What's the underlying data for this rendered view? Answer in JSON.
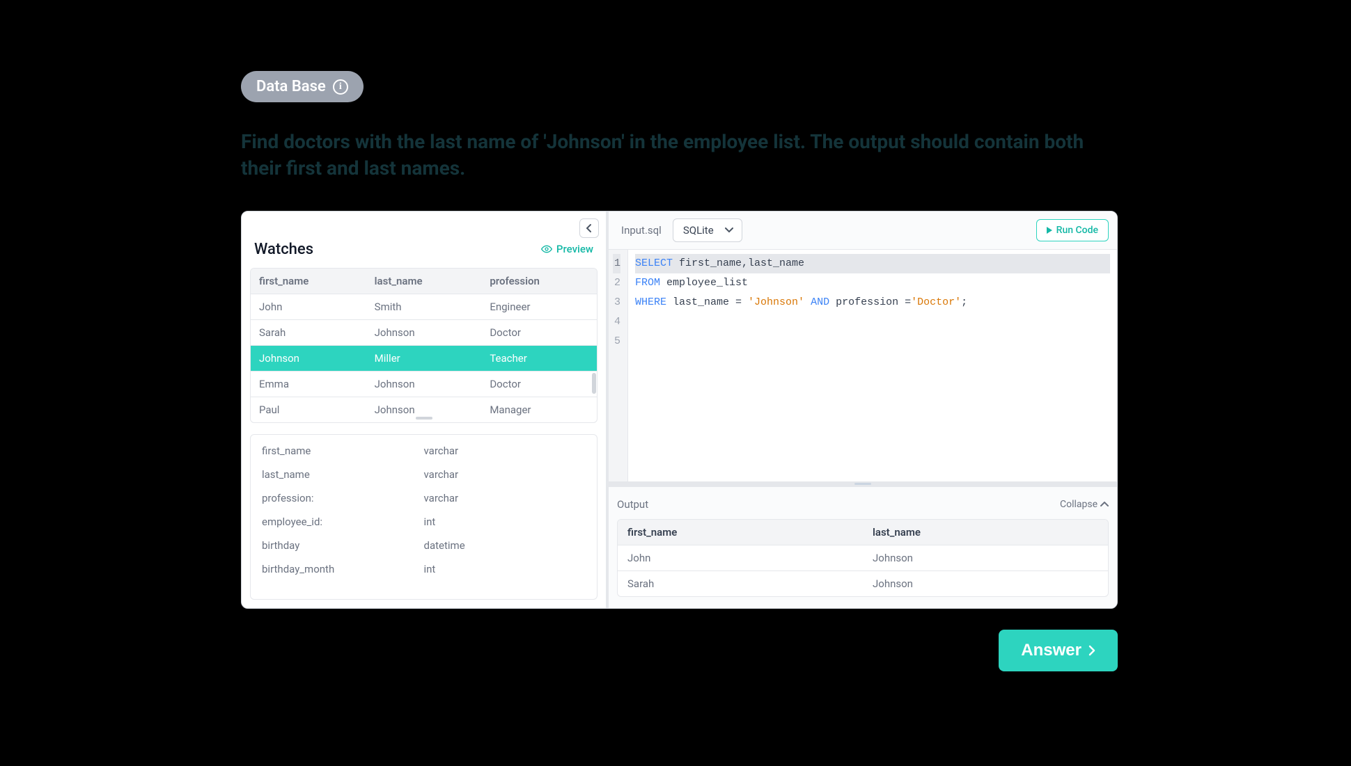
{
  "badge": {
    "label": "Data Base"
  },
  "prompt": "Find doctors with the last name of 'Johnson' in the employee list. The output should contain both their first and last names.",
  "watches": {
    "title": "Watches",
    "preview_label": "Preview",
    "columns": {
      "c1": "first_name",
      "c2": "last_name",
      "c3": "profession"
    },
    "rows": [
      {
        "first": "John",
        "last": "Smith",
        "prof": "Engineer"
      },
      {
        "first": "Sarah",
        "last": "Johnson",
        "prof": "Doctor"
      },
      {
        "first": "Johnson",
        "last": "Miller",
        "prof": "Teacher"
      },
      {
        "first": "Emma",
        "last": "Johnson",
        "prof": "Doctor"
      },
      {
        "first": "Paul",
        "last": "Johnson",
        "prof": "Manager"
      }
    ],
    "highlighted_index": 2
  },
  "schema": [
    {
      "col": "first_name",
      "type": "varchar"
    },
    {
      "col": "last_name",
      "type": "varchar"
    },
    {
      "col": "profession:",
      "type": "varchar"
    },
    {
      "col": "employee_id:",
      "type": "int"
    },
    {
      "col": "birthday",
      "type": "datetime"
    },
    {
      "col": "birthday_month",
      "type": "int"
    }
  ],
  "editor": {
    "filename": "Input.sql",
    "dialect": "SQLite",
    "run_label": "Run Code",
    "code": {
      "l1": {
        "kw1": "SELECT",
        "rest": " first_name,last_name"
      },
      "l2": {
        "kw1": "FROM",
        "rest": " employee_list"
      },
      "l3": {
        "kw1": "WHERE",
        "mid1": " last_name = ",
        "str1": "'Johnson'",
        "kw2": " AND ",
        "mid2": "profession =",
        "str2": "'Doctor'",
        "tail": ";"
      }
    },
    "line_numbers": [
      "1",
      "2",
      "3",
      "4",
      "5"
    ]
  },
  "output": {
    "title": "Output",
    "collapse_label": "Collapse",
    "columns": {
      "c1": "first_name",
      "c2": "last_name"
    },
    "rows": [
      {
        "first": "John",
        "last": "Johnson"
      },
      {
        "first": "Sarah",
        "last": "Johnson"
      }
    ]
  },
  "answer_button": "Answer"
}
